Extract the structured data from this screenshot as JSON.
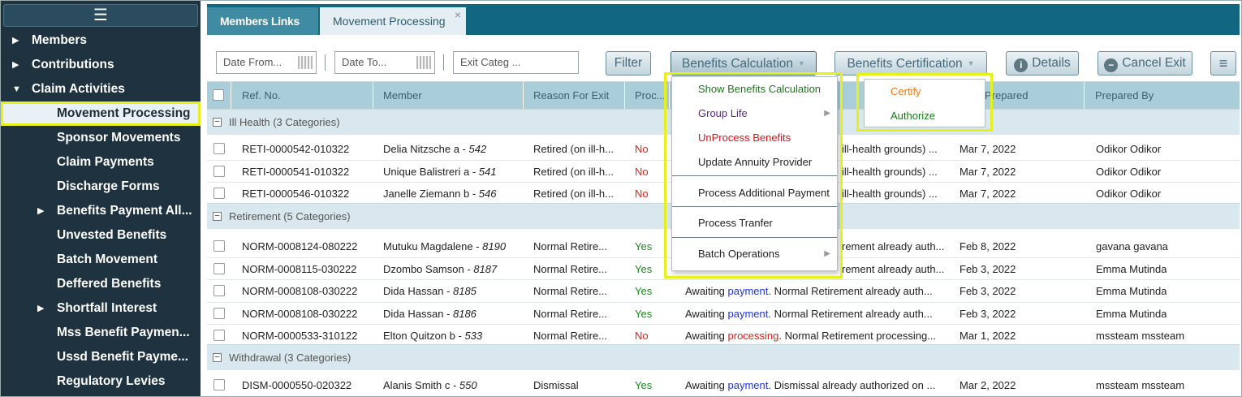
{
  "sidebar": {
    "menu_icon": "hamburger-icon",
    "items": [
      {
        "label": "Members",
        "level": "top",
        "arrow": "▶"
      },
      {
        "label": "Contributions",
        "level": "top",
        "arrow": "▶"
      },
      {
        "label": "Claim Activities",
        "level": "top",
        "arrow": "▼"
      },
      {
        "label": "Movement Processing",
        "level": "sub",
        "arrow": ""
      },
      {
        "label": "Sponsor Movements",
        "level": "sub",
        "arrow": ""
      },
      {
        "label": "Claim Payments",
        "level": "sub",
        "arrow": ""
      },
      {
        "label": "Discharge Forms",
        "level": "sub",
        "arrow": ""
      },
      {
        "label": "Benefits Payment All...",
        "level": "sub",
        "arrow": "▶"
      },
      {
        "label": "Unvested Benefits",
        "level": "sub",
        "arrow": ""
      },
      {
        "label": "Batch Movement",
        "level": "sub",
        "arrow": ""
      },
      {
        "label": "Deffered Benefits",
        "level": "sub",
        "arrow": ""
      },
      {
        "label": "Shortfall Interest",
        "level": "sub",
        "arrow": "▶"
      },
      {
        "label": "Mss Benefit Paymen...",
        "level": "sub",
        "arrow": ""
      },
      {
        "label": "Ussd Benefit Payme...",
        "level": "sub",
        "arrow": ""
      },
      {
        "label": "Regulatory Levies",
        "level": "sub",
        "arrow": ""
      }
    ]
  },
  "tabs": {
    "members_links": "Members Links",
    "movement_processing": "Movement Processing",
    "close": "×"
  },
  "toolbar": {
    "date_from": "Date From...",
    "date_to": "Date To...",
    "exit_category": "Exit Categ  ...",
    "filter": "Filter",
    "benefits_calculation": "Benefits Calculation",
    "benefits_certification": "Benefits Certification",
    "details": "Details",
    "cancel_exit": "Cancel Exit",
    "menu": "≡"
  },
  "grid": {
    "headers": {
      "ref": "Ref. No.",
      "member": "Member",
      "reason": "Reason For Exit",
      "processed": "Proc...",
      "prepared": "Prepared",
      "prepared_by": "Prepared By"
    },
    "groups": [
      {
        "label": "Ill Health (3 Categories)"
      },
      {
        "label": "Retirement (5 Categories)"
      },
      {
        "label": "Withdrawal (3 Categories)"
      }
    ],
    "rows": [
      {
        "ref": "RETI-0000542-010322",
        "member": "Delia Nitzsche a - ",
        "member_no": "542",
        "reason": "Retired (on ill-h...",
        "proc": "No",
        "status_pre": "",
        "status_word": "",
        "status_post": "ill-health grounds) ...",
        "date": "Mar 7, 2022",
        "by": "Odikor Odikor"
      },
      {
        "ref": "RETI-0000541-010322",
        "member": "Unique Balistreri a - ",
        "member_no": "541",
        "reason": "Retired (on ill-h...",
        "proc": "No",
        "status_pre": "",
        "status_word": "",
        "status_post": "ill-health grounds) ...",
        "date": "Mar 7, 2022",
        "by": "Odikor Odikor"
      },
      {
        "ref": "RETI-0000546-010322",
        "member": "Janelle Ziemann b - ",
        "member_no": "546",
        "reason": "Retired (on ill-h...",
        "proc": "No",
        "status_pre": "",
        "status_word": "",
        "status_post": "ill-health grounds) ...",
        "date": "Mar 7, 2022",
        "by": "Odikor Odikor"
      },
      {
        "ref": "NORM-0008124-080222",
        "member": "Mutuku Magdalene - ",
        "member_no": "8190",
        "reason": "Normal Retire...",
        "proc": "Yes",
        "status_pre": "",
        "status_word": "",
        "status_post": "rement already auth...",
        "date": "Feb 8, 2022",
        "by": "gavana gavana"
      },
      {
        "ref": "NORM-0008115-030222",
        "member": "Dzombo Samson - ",
        "member_no": "8187",
        "reason": "Normal Retire...",
        "proc": "Yes",
        "status_pre": "",
        "status_word": "",
        "status_post": "rement already auth...",
        "date": "Feb 3, 2022",
        "by": "Emma Mutinda"
      },
      {
        "ref": "NORM-0008108-030222",
        "member": "Dida Hassan - ",
        "member_no": "8185",
        "reason": "Normal Retire...",
        "proc": "Yes",
        "status_pre": "Awaiting ",
        "status_word": "payment",
        "status_post": ". Normal Retirement already auth...",
        "date": "Feb 3, 2022",
        "by": "Emma Mutinda"
      },
      {
        "ref": "NORM-0008108-030222",
        "member": "Dida Hassan - ",
        "member_no": "8186",
        "reason": "Normal Retire...",
        "proc": "Yes",
        "status_pre": "Awaiting ",
        "status_word": "payment",
        "status_post": ". Normal Retirement already auth...",
        "date": "Feb 3, 2022",
        "by": "Emma Mutinda"
      },
      {
        "ref": "NORM-0000533-310122",
        "member": "Elton Quitzon b - ",
        "member_no": "533",
        "reason": "Normal Retire...",
        "proc": "No",
        "status_pre": "Awaiting ",
        "status_word": "processing",
        "status_post": ". Normal Retirement processing...",
        "date": "Mar 1, 2022",
        "by": "mssteam mssteam"
      },
      {
        "ref": "DISM-0000550-020322",
        "member": "Alanis Smith c - ",
        "member_no": "550",
        "reason": "Dismissal",
        "proc": "Yes",
        "status_pre": "Awaiting ",
        "status_word": "payment",
        "status_post": ". Dismissal already authorized on ...",
        "date": "Mar 2, 2022",
        "by": "mssteam mssteam"
      }
    ]
  },
  "benefits_menu": [
    {
      "label": "Show Benefits Calculation",
      "color": "#1a7a1a",
      "submenu": false
    },
    {
      "label": "Group Life",
      "color": "#5a2a8a",
      "submenu": true
    },
    {
      "label": "UnProcess Benefits",
      "color": "#dd1111",
      "submenu": false
    },
    {
      "label": "Update Annuity Provider",
      "color": "#222222",
      "submenu": false
    },
    {
      "label": "Process Additional Payment",
      "color": "#222222",
      "submenu": false
    },
    {
      "label": "Process Tranfer",
      "color": "#222222",
      "submenu": false
    },
    {
      "label": "Batch Operations",
      "color": "#222222",
      "submenu": true
    }
  ],
  "certification_menu": [
    {
      "label": "Certify",
      "color": "#f07c12"
    },
    {
      "label": "Authorize",
      "color": "#1a7a1a"
    }
  ],
  "colors": {
    "sidebar_bg": "#1e3240",
    "tabbar_bg": "#11677f",
    "header_bg": "#a9cdd9",
    "highlight": "#e6f11a",
    "no": "#dd1111",
    "yes": "#1a8c1a"
  }
}
